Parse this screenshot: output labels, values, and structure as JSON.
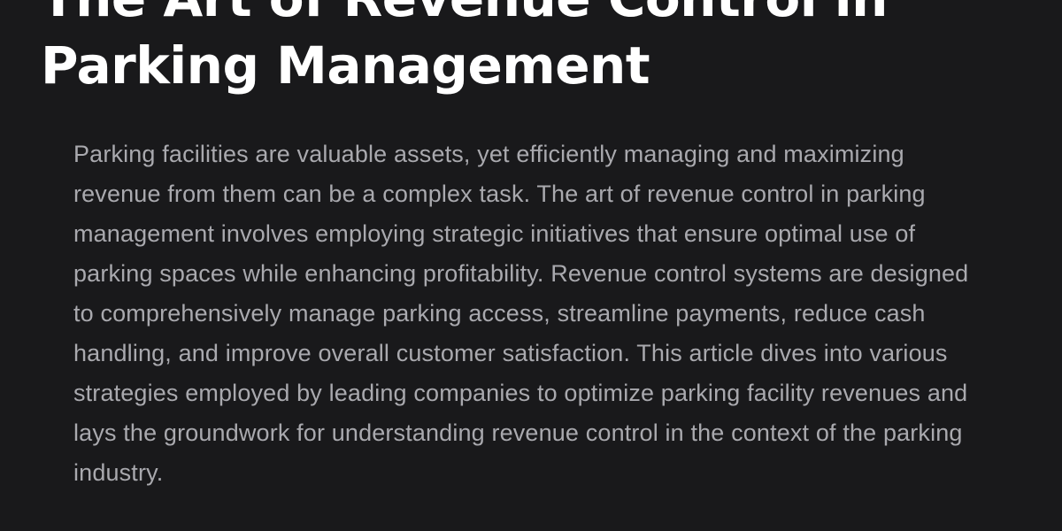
{
  "article": {
    "title": "The Art of Revenue Control in Parking Management",
    "intro": "Parking facilities are valuable assets, yet efficiently managing and maximizing revenue from them can be a complex task. The art of revenue control in parking management involves employing strategic initiatives that ensure optimal use of parking spaces while enhancing profitability. Revenue control systems are designed to comprehensively manage parking access, streamline payments, reduce cash handling, and improve overall customer satisfaction. This article dives into various strategies employed by leading companies to optimize parking facility revenues and lays the groundwork for understanding revenue control in the context of the parking industry."
  },
  "colors": {
    "background": "#19191b",
    "title": "#ffffff",
    "body_text": "#a9a9ae"
  }
}
